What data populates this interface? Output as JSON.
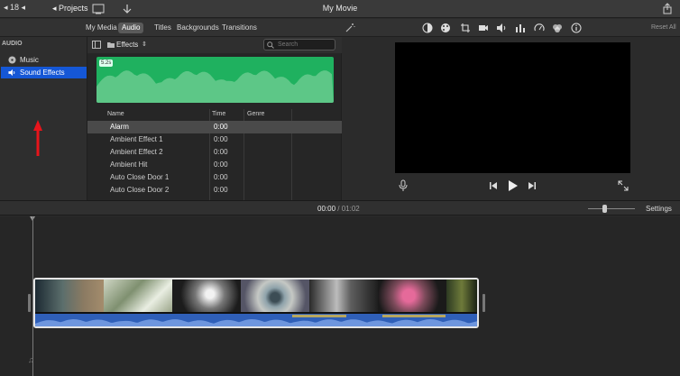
{
  "titlebar": {
    "back_label": "◂ Projects",
    "prefix_label": "◂ 18 ◂",
    "window_title": "My Movie"
  },
  "tabs": [
    {
      "label": "My Media",
      "active": false
    },
    {
      "label": "Audio",
      "active": true
    },
    {
      "label": "Titles",
      "active": false
    },
    {
      "label": "Backgrounds",
      "active": false
    },
    {
      "label": "Transitions",
      "active": false
    }
  ],
  "viewer_toolbar": {
    "reset_all_label": "Reset All",
    "icons": [
      "magic-wand-icon",
      "color-balance-icon",
      "color-palette-icon",
      "crop-icon",
      "camera-stabilize-icon",
      "volume-icon",
      "equalizer-icon",
      "speed-icon",
      "filter-icon",
      "info-icon"
    ]
  },
  "sidebar": {
    "heading": "AUDIO",
    "items": [
      {
        "label": "Music",
        "icon": "music-icon",
        "selected": false
      },
      {
        "label": "Sound Effects",
        "icon": "speaker-icon",
        "selected": true
      }
    ]
  },
  "browser": {
    "title": "Effects",
    "search_placeholder": "Search",
    "preview_duration": "5.2s",
    "columns": [
      "Name",
      "Time",
      "Genre"
    ],
    "rows": [
      {
        "name": "Alarm",
        "time": "0:00",
        "selected": true
      },
      {
        "name": "Ambient Effect 1",
        "time": "0:00",
        "selected": false
      },
      {
        "name": "Ambient Effect 2",
        "time": "0:00",
        "selected": false
      },
      {
        "name": "Ambient Hit",
        "time": "0:00",
        "selected": false
      },
      {
        "name": "Auto Close Door 1",
        "time": "0:00",
        "selected": false
      },
      {
        "name": "Auto Close Door 2",
        "time": "0:00",
        "selected": false
      }
    ]
  },
  "timeline": {
    "current_time": "00:00",
    "separator": "/",
    "duration": "01:02",
    "settings_label": "Settings"
  },
  "colors": {
    "accent": "#1557d6",
    "waveform": "#1fb15f",
    "annotation_arrow": "#e8141b",
    "audio_track": "#2f5fb8"
  }
}
